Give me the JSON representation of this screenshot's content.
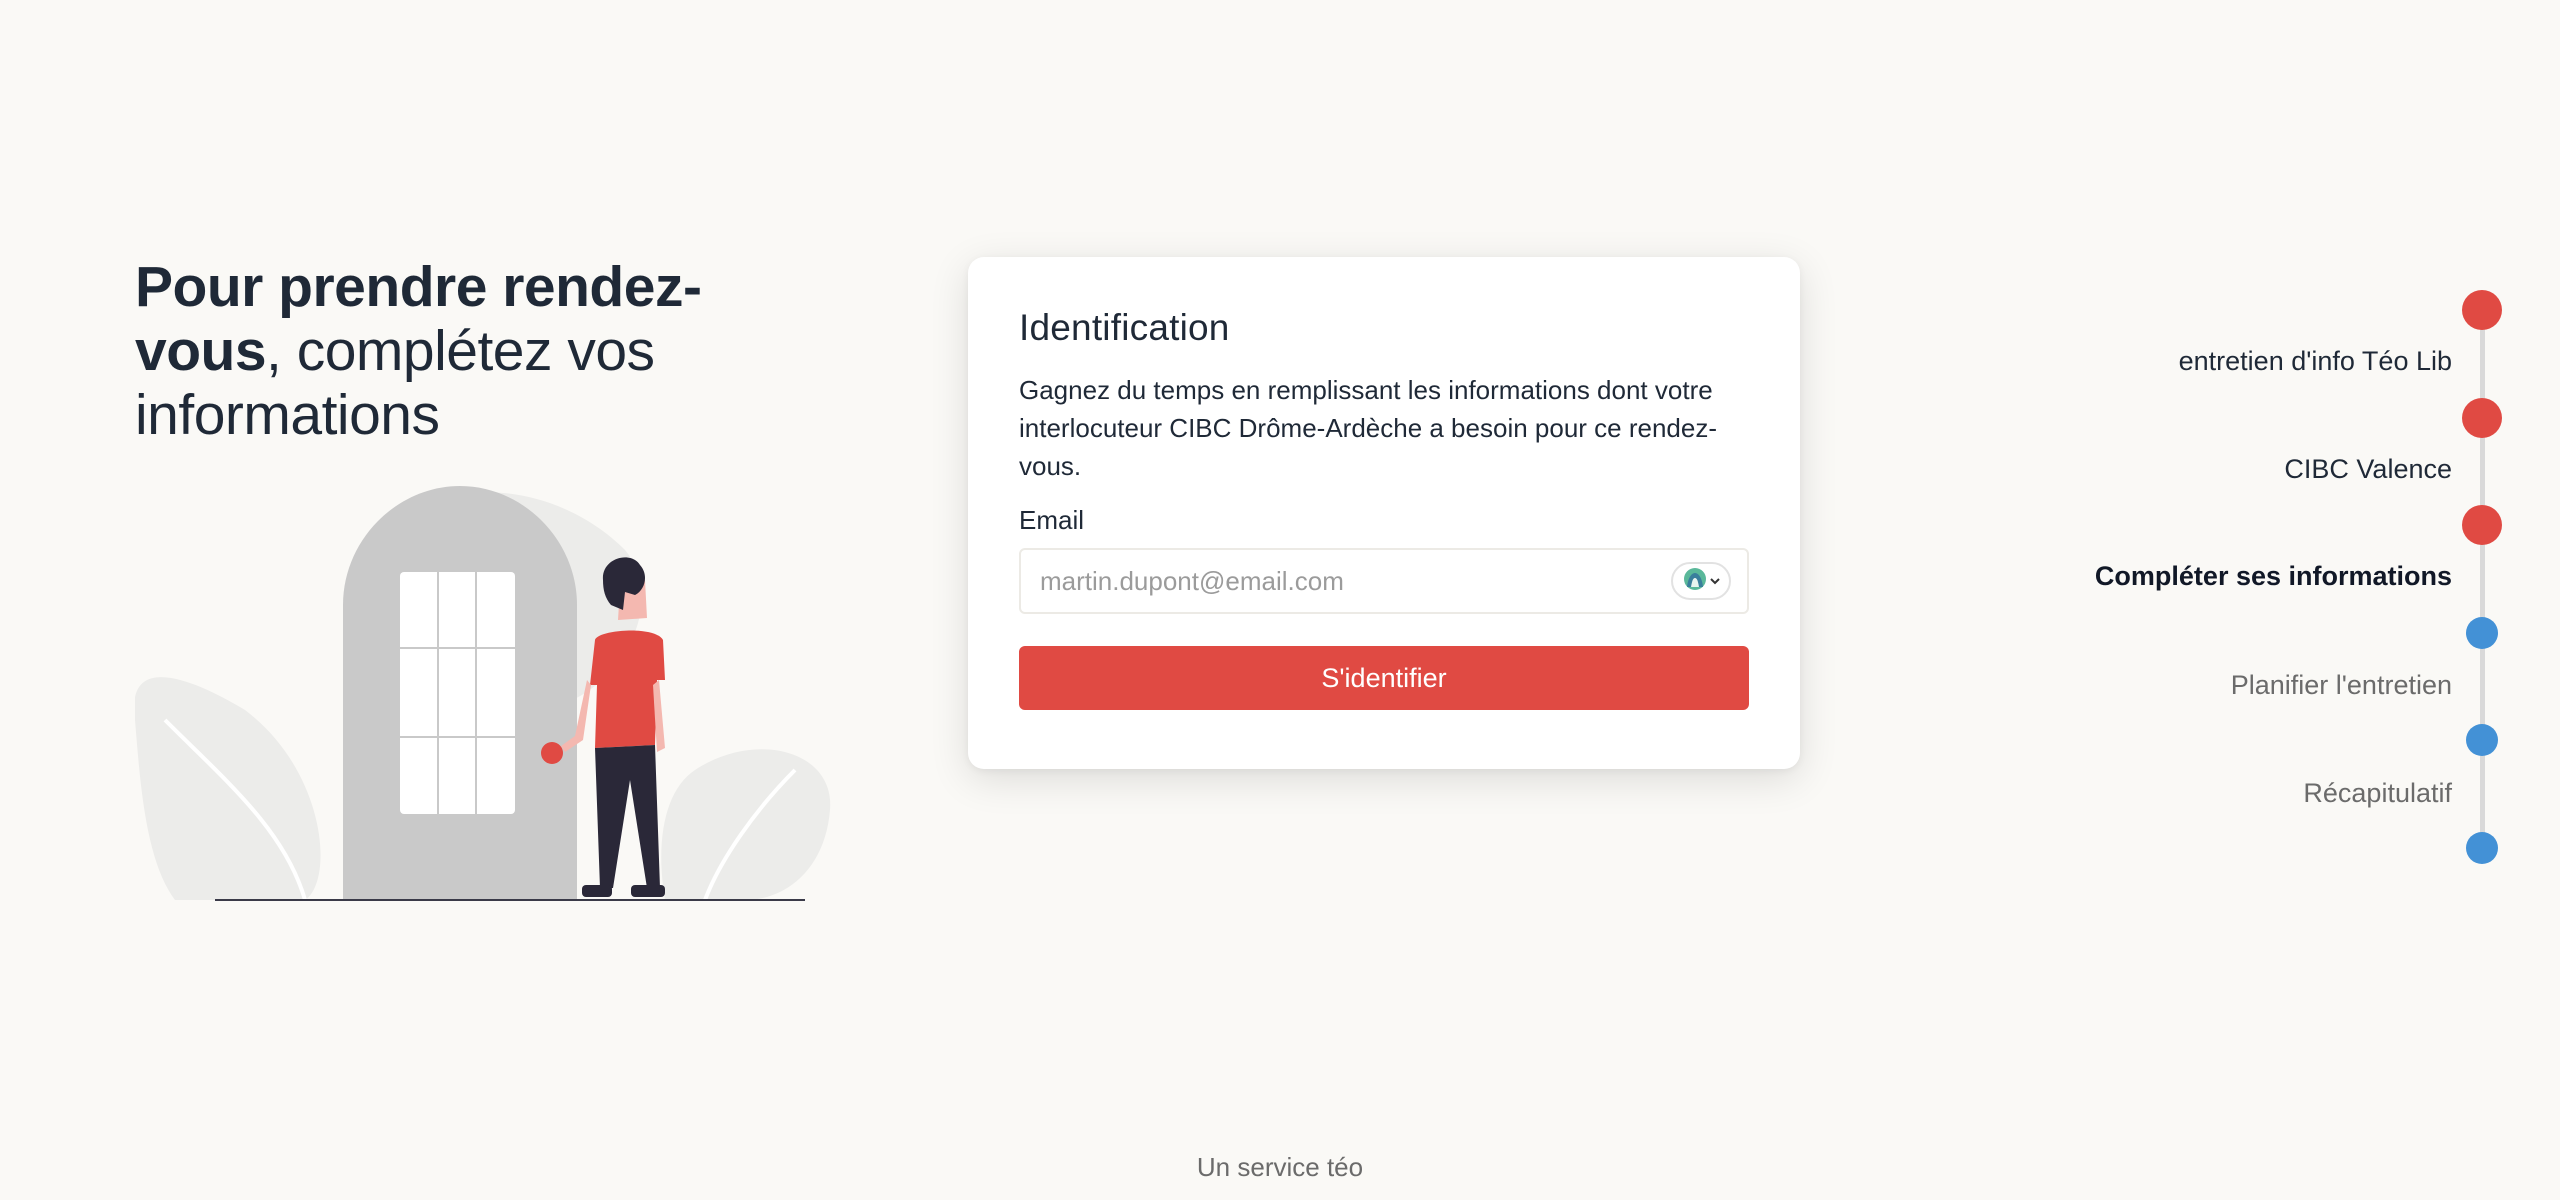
{
  "hero": {
    "title_strong": "Pour prendre rendez-vous",
    "title_rest": ", complétez vos informations"
  },
  "card": {
    "title": "Identification",
    "description": "Gagnez du temps en remplissant les informations dont votre interlocuteur CIBC Drôme-Ardèche a besoin pour ce rendez-vous.",
    "email_label": "Email",
    "email_placeholder": "martin.dupont@email.com",
    "email_value": "",
    "submit_label": "S'identifier"
  },
  "stepper": {
    "steps": [
      {
        "label": "entretien d'info Téo Lib",
        "status": "done"
      },
      {
        "label": "CIBC Valence",
        "status": "done"
      },
      {
        "label": "Compléter ses informations",
        "status": "current"
      },
      {
        "label": "Planifier l'entretien",
        "status": "todo"
      },
      {
        "label": "Récapitulatif",
        "status": "todo"
      }
    ]
  },
  "footer": {
    "text": "Un service téo"
  },
  "colors": {
    "accent": "#e04a43",
    "step_todo": "#4391d6",
    "background": "#faf9f6"
  },
  "icons": {
    "password_manager": "password-manager-icon",
    "chevron": "chevron-down-icon"
  }
}
